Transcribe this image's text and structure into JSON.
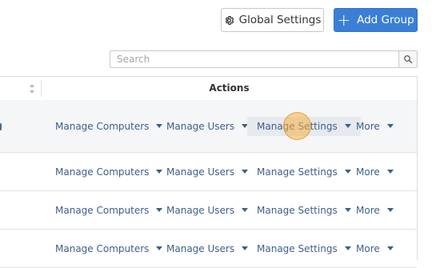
{
  "toolbar": {
    "global_settings_label": "Global Settings",
    "add_group_label": "Add Group",
    "add_group_icon": "plus-icon",
    "global_settings_icon": "gear-icon"
  },
  "search": {
    "placeholder": "Search",
    "value": "",
    "icon": "search-icon"
  },
  "table": {
    "headers": {
      "actions": "Actions"
    },
    "rows": [
      {
        "actions": [
          "Manage Computers",
          "Manage Users",
          "Manage Settings",
          "More"
        ],
        "highlighted": "Manage Settings"
      },
      {
        "actions": [
          "Manage Computers",
          "Manage Users",
          "Manage Settings",
          "More"
        ]
      },
      {
        "actions": [
          "Manage Computers",
          "Manage Users",
          "Manage Settings",
          "More"
        ]
      },
      {
        "actions": [
          "Manage Computers",
          "Manage Users",
          "Manage Settings",
          "More"
        ]
      }
    ]
  },
  "colors": {
    "primary_button": "#3a7fd5",
    "link": "#3d5f8a",
    "cursor_highlight": "#f5b041"
  }
}
